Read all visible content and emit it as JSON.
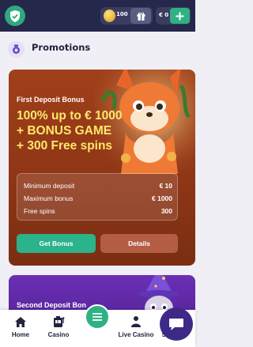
{
  "header": {
    "coins": "100",
    "balance": "€ 0"
  },
  "page": {
    "title": "Promotions"
  },
  "promo_card": {
    "subtitle": "First Deposit Bonus",
    "headline_lines": [
      "100% up to € 1000",
      "+ BONUS GAME",
      "+ 300 Free spins"
    ],
    "details": [
      {
        "label": "Minimum deposit",
        "value": "€ 10"
      },
      {
        "label": "Maximum bonus",
        "value": "€ 1000"
      },
      {
        "label": "Free spins",
        "value": "300"
      }
    ],
    "get_bonus_label": "Get Bonus",
    "details_label": "Details"
  },
  "promo_card_2": {
    "subtitle": "Second Deposit Bon"
  },
  "bottom_nav": {
    "items": [
      {
        "label": "Home",
        "icon": "home-icon"
      },
      {
        "label": "Casino",
        "icon": "slot-machine-icon"
      },
      {
        "label": "Live Casino",
        "icon": "dealer-icon"
      },
      {
        "label": "Search",
        "icon": "search-icon"
      }
    ]
  },
  "colors": {
    "header_bg": "#25284a",
    "accent_green": "#2fb185",
    "card_orange": "#9a3c18",
    "headline_yellow": "#fde86a",
    "chat_purple": "#3e2a86"
  }
}
